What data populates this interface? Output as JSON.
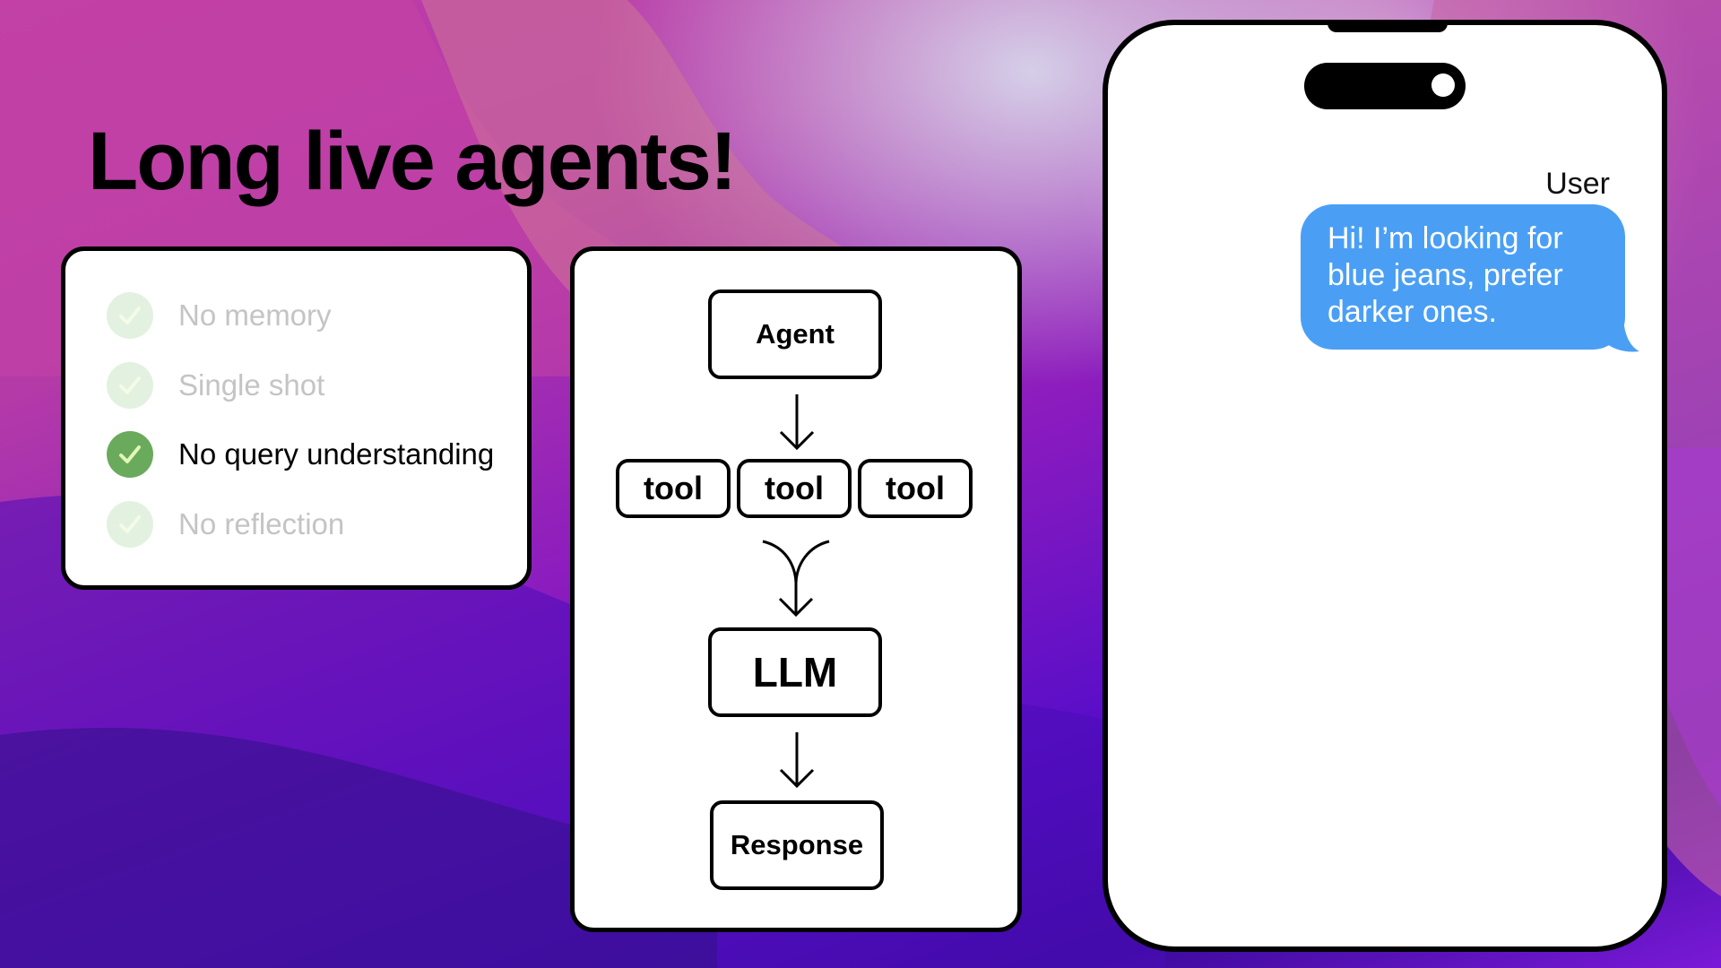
{
  "slide": {
    "title": "Long live agents!"
  },
  "checklist": {
    "items": [
      {
        "label": "No memory",
        "state": "dimmed",
        "icon": "check-icon"
      },
      {
        "label": "Single shot",
        "state": "dimmed",
        "icon": "check-icon"
      },
      {
        "label": "No query understanding",
        "state": "active",
        "icon": "check-icon"
      },
      {
        "label": "No reflection",
        "state": "dimmed",
        "icon": "check-icon"
      }
    ],
    "colors": {
      "active_check": "#6aaa5c",
      "dimmed_check": "#e3f1e0",
      "dimmed_text": "#c4c4c4"
    }
  },
  "diagram": {
    "nodes": {
      "agent": "Agent",
      "tools": [
        "tool",
        "tool",
        "tool"
      ],
      "llm": "LLM",
      "response": "Response"
    },
    "edges": [
      {
        "from": "Agent",
        "to": "tools"
      },
      {
        "from": "tools",
        "to": "LLM",
        "style": "merge"
      },
      {
        "from": "LLM",
        "to": "Response"
      }
    ]
  },
  "phone": {
    "sender": "User",
    "message": "Hi! I’m looking for blue jeans, prefer darker ones.",
    "bubble_color": "#4a9ff5"
  }
}
